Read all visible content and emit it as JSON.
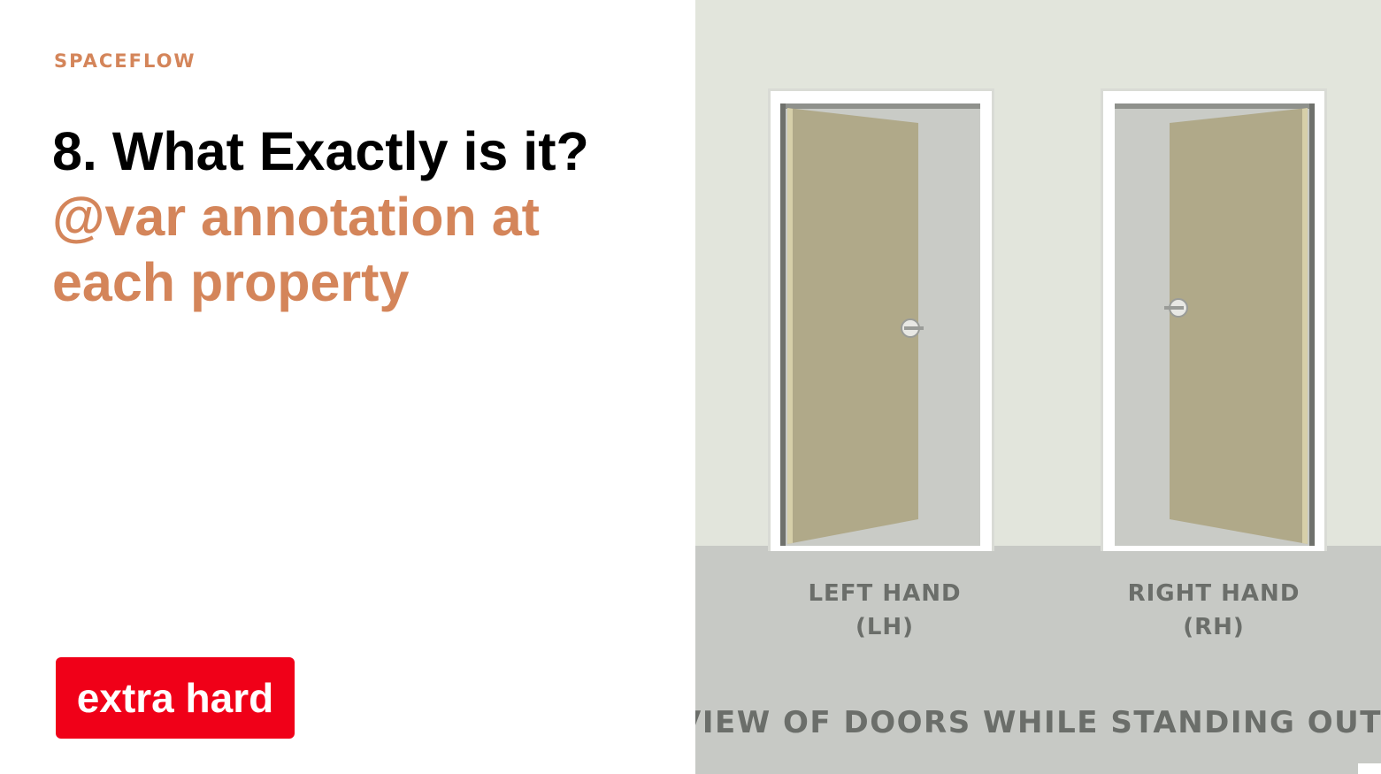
{
  "brand": "SPACEFLOW",
  "title": "8. What Exactly is it?",
  "subtitle": "@var annotation at each property",
  "badge": "extra hard",
  "illustration": {
    "left_label": [
      "LEFT HAND",
      "(LH)"
    ],
    "right_label": [
      "RIGHT HAND",
      "(RH)"
    ],
    "caption": "VIEW OF DOORS WHILE STANDING OUTSIDE"
  },
  "colors": {
    "accent": "#d4855a",
    "badge": "#f00018",
    "door": "#b0a989",
    "wall": "#e2e5dc",
    "floor": "#c7c9c5"
  }
}
